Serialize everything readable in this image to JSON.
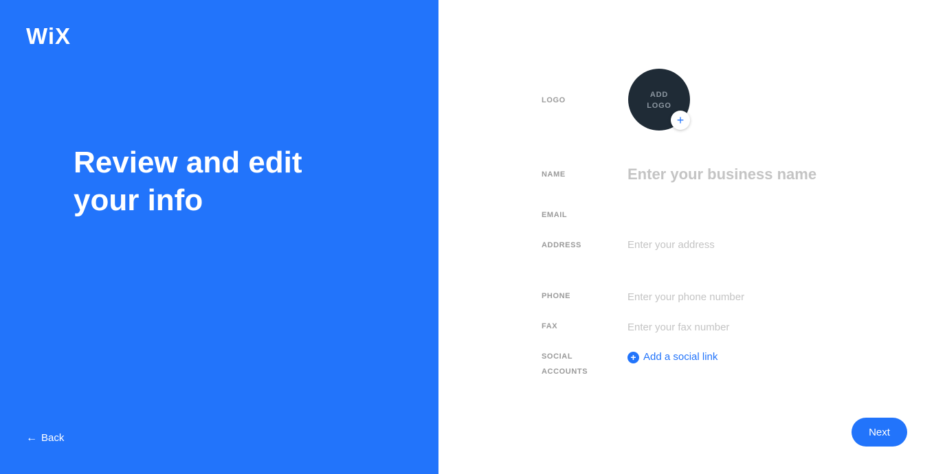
{
  "brand": {
    "logo_text": "WiX",
    "accent_color": "#2274fb",
    "panel_color": "#2274fb"
  },
  "left": {
    "headline": "Review and edit your info",
    "back": {
      "icon": "arrow-left-icon",
      "label": "Back"
    }
  },
  "form": {
    "logo": {
      "label": "LOGO",
      "upload_text": "ADD\nLOGO",
      "plus_icon": "plus-icon",
      "circle_color": "#1f2b36"
    },
    "name": {
      "label": "NAME",
      "value": "",
      "placeholder": "Enter your business name"
    },
    "email": {
      "label": "EMAIL",
      "value": "",
      "placeholder": ""
    },
    "address": {
      "label": "ADDRESS",
      "value": "",
      "placeholder": "Enter your address"
    },
    "phone": {
      "label": "PHONE",
      "value": "",
      "placeholder": "Enter your phone number"
    },
    "fax": {
      "label": "FAX",
      "value": "",
      "placeholder": "Enter your fax number"
    },
    "social": {
      "label_line1": "SOCIAL",
      "label_line2": "ACCOUNTS",
      "link_icon": "plus-circle-icon",
      "link_label": "Add a social link"
    }
  },
  "actions": {
    "next_label": "Next"
  }
}
